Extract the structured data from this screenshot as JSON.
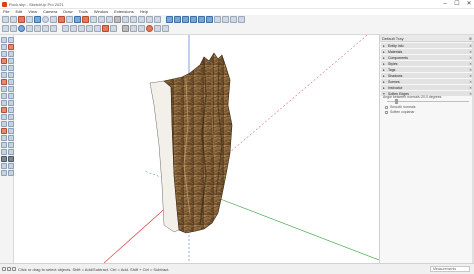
{
  "window": {
    "title": "Rock.skp - SketchUp Pro 2021",
    "controls": [
      "–",
      "☐",
      "✕"
    ]
  },
  "menu": [
    "File",
    "Edit",
    "View",
    "Camera",
    "Draw",
    "Tools",
    "Window",
    "Extensions",
    "Help"
  ],
  "tray": {
    "title": "Default Tray",
    "pin": "⊕",
    "panels": [
      {
        "label": "Entity Info",
        "expanded": false
      },
      {
        "label": "Materials",
        "expanded": false
      },
      {
        "label": "Components",
        "expanded": false
      },
      {
        "label": "Styles",
        "expanded": false
      },
      {
        "label": "Tags",
        "expanded": false
      },
      {
        "label": "Shadows",
        "expanded": false
      },
      {
        "label": "Scenes",
        "expanded": false
      },
      {
        "label": "Instructor",
        "expanded": false
      },
      {
        "label": "Soften Edges",
        "expanded": true
      }
    ],
    "soften": {
      "angle_label": "Angle between normals:",
      "angle_value": "20.0  degrees",
      "smooth_normals": "Smooth normals",
      "soften_coplanar": "Soften coplanar",
      "slider_fraction": 0.11
    }
  },
  "status": {
    "text": "Click or drag to select objects. Shift = Add/Subtract. Ctrl = Add. Shift + Ctrl = Subtract.",
    "measurements_label": "Measurements"
  },
  "colors": {
    "rock_dark": "#5a3f22",
    "rock_mid": "#8a6a3e",
    "rock_light": "#b89464",
    "rock_side": "#f3f0ea",
    "axis_red": "#d22d2d",
    "axis_green": "#2e9d36",
    "axis_blue": "#2f5fc8"
  }
}
